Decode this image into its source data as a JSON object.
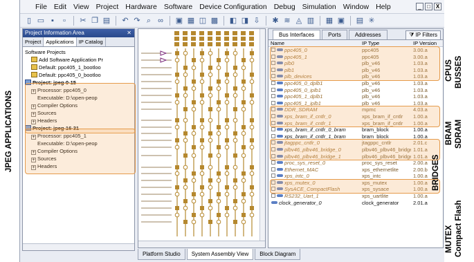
{
  "menu": [
    "File",
    "Edit",
    "View",
    "Project",
    "Hardware",
    "Software",
    "Device Configuration",
    "Debug",
    "Simulation",
    "Window",
    "Help"
  ],
  "window_controls": [
    "_",
    "□",
    "X"
  ],
  "left_panel": {
    "title": "Project Information Area",
    "close": "✕",
    "tabs": [
      "Project",
      "Applications",
      "IP Catalog"
    ],
    "tree": [
      {
        "text": "Software Projects",
        "level": 0,
        "icon": "none",
        "bold": false
      },
      {
        "text": "Add Software Application Pr",
        "level": 1,
        "icon": "app",
        "bold": false
      },
      {
        "text": "Default: ppc405_1_bootloo",
        "level": 1,
        "icon": "app",
        "bold": false
      },
      {
        "text": "Default: ppc405_0_bootloo",
        "level": 1,
        "icon": "app",
        "bold": false
      },
      {
        "text": "Project: jpeg-0-15",
        "level": 0,
        "icon": "project",
        "bold": true
      },
      {
        "text": "Processor: ppc405_0",
        "level": 1,
        "icon": "plus",
        "bold": false
      },
      {
        "text": "Executable: D:\\open-peop",
        "level": 2,
        "icon": "none",
        "bold": false
      },
      {
        "text": "Compiler Options",
        "level": 1,
        "icon": "plus",
        "bold": false
      },
      {
        "text": "Sources",
        "level": 1,
        "icon": "plus",
        "bold": false
      },
      {
        "text": "Headers",
        "level": 1,
        "icon": "plus",
        "bold": false
      },
      {
        "text": "Project: jpeg-16-31",
        "level": 0,
        "icon": "project",
        "bold": true
      },
      {
        "text": "Processor: ppc405_1",
        "level": 1,
        "icon": "plus",
        "bold": false
      },
      {
        "text": "Executable: D:\\open-peop",
        "level": 2,
        "icon": "none",
        "bold": false
      },
      {
        "text": "Compiler Options",
        "level": 1,
        "icon": "plus",
        "bold": false
      },
      {
        "text": "Sources",
        "level": 1,
        "icon": "plus",
        "bold": false
      },
      {
        "text": "Headers",
        "level": 1,
        "icon": "plus",
        "bold": false
      }
    ]
  },
  "right_panel": {
    "tabs": [
      "Bus Interfaces",
      "Ports",
      "Addresses"
    ],
    "filters_button": "IP Filters",
    "columns": [
      "Name",
      "IP Type",
      "IP Version"
    ],
    "rows": [
      {
        "name": "ppc405_0",
        "type": "ppc405",
        "version": "3.00.a",
        "dark": false
      },
      {
        "name": "ppc405_1",
        "type": "ppc405",
        "version": "3.00.a",
        "dark": false
      },
      {
        "name": "plb0",
        "type": "plb_v46",
        "version": "1.03.a",
        "dark": false
      },
      {
        "name": "plb1",
        "type": "plb_v46",
        "version": "1.03.a",
        "dark": false
      },
      {
        "name": "plb_devices",
        "type": "plb_v46",
        "version": "1.03.a",
        "dark": false
      },
      {
        "name": "ppc405_0_dplb1",
        "type": "plb_v46",
        "version": "1.03.a",
        "dark": false
      },
      {
        "name": "ppc405_0_iplb1",
        "type": "plb_v46",
        "version": "1.03.a",
        "dark": false
      },
      {
        "name": "ppc405_1_dplb1",
        "type": "plb_v46",
        "version": "1.03.a",
        "dark": false
      },
      {
        "name": "ppc405_1_iplb1",
        "type": "plb_v46",
        "version": "1.03.a",
        "dark": false
      },
      {
        "name": "DDR_SDRAM",
        "type": "mpmc",
        "version": "4.03.a",
        "dark": false
      },
      {
        "name": "xps_bram_if_cntlr_0",
        "type": "xps_bram_if_cntlr",
        "version": "1.00.a",
        "dark": false
      },
      {
        "name": "xps_bram_if_cntlr_1",
        "type": "xps_bram_if_cntlr",
        "version": "1.00.a",
        "dark": false
      },
      {
        "name": "xps_bram_if_cntlr_0_bram",
        "type": "bram_block",
        "version": "1.00.a",
        "dark": true
      },
      {
        "name": "xps_bram_if_cntlr_1_bram",
        "type": "bram_block",
        "version": "1.00.a",
        "dark": true
      },
      {
        "name": "jtagppc_cntlr_0",
        "type": "jtagppc_cntlr",
        "version": "2.01.c",
        "dark": false
      },
      {
        "name": "plbv46_plbv46_bridge_0",
        "type": "plbv46_plbv46_bridge",
        "version": "1.01.a",
        "dark": false
      },
      {
        "name": "plbv46_plbv46_bridge_1",
        "type": "plbv46_plbv46_bridge",
        "version": "1.01.a",
        "dark": false
      },
      {
        "name": "proc_sys_reset_0",
        "type": "proc_sys_reset",
        "version": "2.00.a",
        "dark": false
      },
      {
        "name": "Ethernet_MAC",
        "type": "xps_ethernetlite",
        "version": "2.00.b",
        "dark": false
      },
      {
        "name": "xps_intc_0",
        "type": "xps_intc",
        "version": "1.00.a",
        "dark": false
      },
      {
        "name": "xps_mutex_0",
        "type": "xps_mutex",
        "version": "1.00.a",
        "dark": false
      },
      {
        "name": "SysACE_CompactFlash",
        "type": "xps_sysace",
        "version": "1.00.a",
        "dark": false
      },
      {
        "name": "RS232_Uart_1",
        "type": "xps_uartlite",
        "version": "1.00.a",
        "dark": false
      },
      {
        "name": "clock_generator_0",
        "type": "clock_generator",
        "version": "2.01.a",
        "dark": true
      }
    ]
  },
  "bottom_tabs": [
    "Platform Studio",
    "System Assembly View",
    "Block Diagram"
  ],
  "annotations": {
    "left": "JPEG APPLICATIONS",
    "cpus": "CPUS",
    "busses": "BUSSES",
    "bram": "BRAM",
    "sdram": "SDRAM",
    "bridges": "BRIDGES",
    "mutex": "MUTEX",
    "compact_flash": "Compact Flash"
  },
  "colors": {
    "highlight_border": "#e59a4a",
    "highlight_fill": "#f5b46e",
    "bus_gold": "#b5882e",
    "title_blue": "#2a4a8c"
  }
}
